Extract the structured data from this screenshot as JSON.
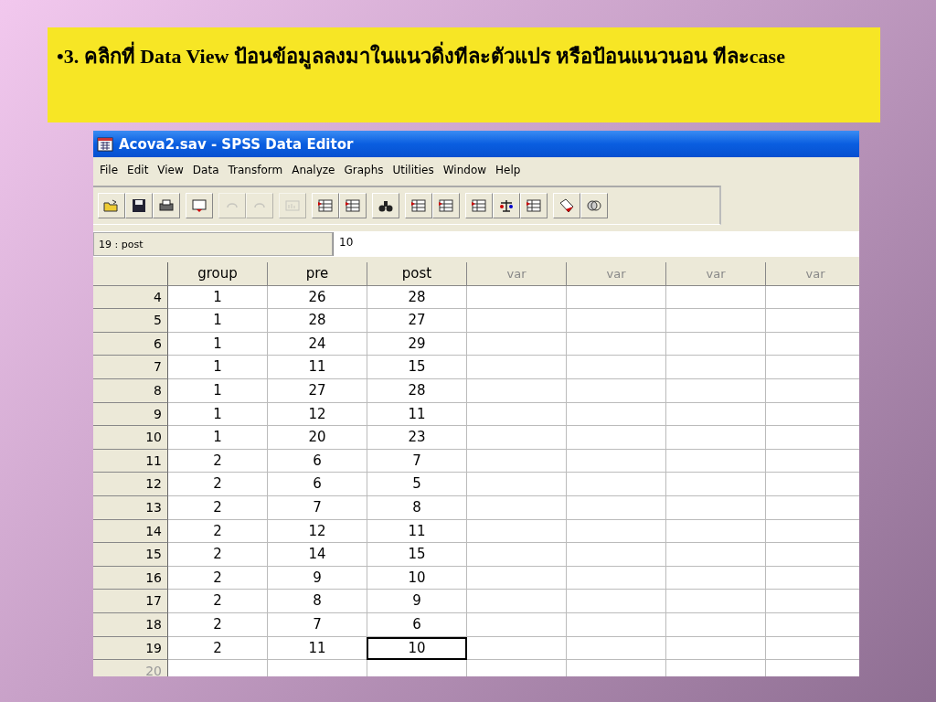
{
  "slide": {
    "heading": "•3. คลิกที่ Data View ป้อนข้อมูลลงมาในแนวดิ่งทีละตัวแปร หรือป้อนแนวนอน ทีละcase"
  },
  "window": {
    "title": "Acova2.sav - SPSS Data Editor"
  },
  "menu": [
    "File",
    "Edit",
    "View",
    "Data",
    "Transform",
    "Analyze",
    "Graphs",
    "Utilities",
    "Window",
    "Help"
  ],
  "toolbar": [
    [
      {
        "disabled": false
      },
      {
        "disabled": false
      },
      {
        "disabled": false
      }
    ],
    [
      {
        "disabled": false
      }
    ],
    [
      {
        "disabled": true
      },
      {
        "disabled": true
      }
    ],
    [
      {
        "disabled": true
      }
    ],
    [
      {
        "disabled": false
      },
      {
        "disabled": false
      }
    ],
    [
      {
        "disabled": false
      }
    ],
    [
      {
        "disabled": false
      },
      {
        "disabled": false
      }
    ],
    [
      {
        "disabled": false
      },
      {
        "disabled": false
      },
      {
        "disabled": false
      }
    ],
    [
      {
        "disabled": false
      },
      {
        "disabled": false
      }
    ]
  ],
  "cell_editor": {
    "cell": "19 : post",
    "value": "10"
  },
  "table": {
    "columns": [
      {
        "label": "group",
        "defined": true
      },
      {
        "label": "pre",
        "defined": true
      },
      {
        "label": "post",
        "defined": true
      },
      {
        "label": "var",
        "defined": false
      },
      {
        "label": "var",
        "defined": false
      },
      {
        "label": "var",
        "defined": false
      },
      {
        "label": "var",
        "defined": false
      }
    ],
    "rows": [
      {
        "label": "4",
        "empty": false,
        "cells": [
          {
            "value": "1",
            "selected": false
          },
          {
            "value": "26",
            "selected": false
          },
          {
            "value": "28",
            "selected": false
          }
        ]
      },
      {
        "label": "5",
        "empty": false,
        "cells": [
          {
            "value": "1",
            "selected": false
          },
          {
            "value": "28",
            "selected": false
          },
          {
            "value": "27",
            "selected": false
          }
        ]
      },
      {
        "label": "6",
        "empty": false,
        "cells": [
          {
            "value": "1",
            "selected": false
          },
          {
            "value": "24",
            "selected": false
          },
          {
            "value": "29",
            "selected": false
          }
        ]
      },
      {
        "label": "7",
        "empty": false,
        "cells": [
          {
            "value": "1",
            "selected": false
          },
          {
            "value": "11",
            "selected": false
          },
          {
            "value": "15",
            "selected": false
          }
        ]
      },
      {
        "label": "8",
        "empty": false,
        "cells": [
          {
            "value": "1",
            "selected": false
          },
          {
            "value": "27",
            "selected": false
          },
          {
            "value": "28",
            "selected": false
          }
        ]
      },
      {
        "label": "9",
        "empty": false,
        "cells": [
          {
            "value": "1",
            "selected": false
          },
          {
            "value": "12",
            "selected": false
          },
          {
            "value": "11",
            "selected": false
          }
        ]
      },
      {
        "label": "10",
        "empty": false,
        "cells": [
          {
            "value": "1",
            "selected": false
          },
          {
            "value": "20",
            "selected": false
          },
          {
            "value": "23",
            "selected": false
          }
        ]
      },
      {
        "label": "11",
        "empty": false,
        "cells": [
          {
            "value": "2",
            "selected": false
          },
          {
            "value": "6",
            "selected": false
          },
          {
            "value": "7",
            "selected": false
          }
        ]
      },
      {
        "label": "12",
        "empty": false,
        "cells": [
          {
            "value": "2",
            "selected": false
          },
          {
            "value": "6",
            "selected": false
          },
          {
            "value": "5",
            "selected": false
          }
        ]
      },
      {
        "label": "13",
        "empty": false,
        "cells": [
          {
            "value": "2",
            "selected": false
          },
          {
            "value": "7",
            "selected": false
          },
          {
            "value": "8",
            "selected": false
          }
        ]
      },
      {
        "label": "14",
        "empty": false,
        "cells": [
          {
            "value": "2",
            "selected": false
          },
          {
            "value": "12",
            "selected": false
          },
          {
            "value": "11",
            "selected": false
          }
        ]
      },
      {
        "label": "15",
        "empty": false,
        "cells": [
          {
            "value": "2",
            "selected": false
          },
          {
            "value": "14",
            "selected": false
          },
          {
            "value": "15",
            "selected": false
          }
        ]
      },
      {
        "label": "16",
        "empty": false,
        "cells": [
          {
            "value": "2",
            "selected": false
          },
          {
            "value": "9",
            "selected": false
          },
          {
            "value": "10",
            "selected": false
          }
        ]
      },
      {
        "label": "17",
        "empty": false,
        "cells": [
          {
            "value": "2",
            "selected": false
          },
          {
            "value": "8",
            "selected": false
          },
          {
            "value": "9",
            "selected": false
          }
        ]
      },
      {
        "label": "18",
        "empty": false,
        "cells": [
          {
            "value": "2",
            "selected": false
          },
          {
            "value": "7",
            "selected": false
          },
          {
            "value": "6",
            "selected": false
          }
        ]
      },
      {
        "label": "19",
        "empty": false,
        "cells": [
          {
            "value": "2",
            "selected": false
          },
          {
            "value": "11",
            "selected": false
          },
          {
            "value": "10",
            "selected": true
          }
        ]
      },
      {
        "label": "20",
        "empty": true,
        "cells": []
      }
    ]
  }
}
